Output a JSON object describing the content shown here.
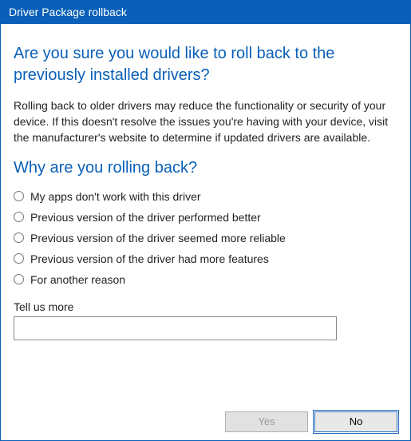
{
  "title": "Driver Package rollback",
  "heading": "Are you sure you would like to roll back to the previously installed drivers?",
  "body": "Rolling back to older drivers may reduce the functionality or security of your device.  If this doesn't resolve the issues you're having with your device, visit the manufacturer's website to determine if updated drivers are available.",
  "subheading": "Why are you rolling back?",
  "options": [
    "My apps don't work with this driver",
    "Previous version of the driver performed better",
    "Previous version of the driver seemed more reliable",
    "Previous version of the driver had more features",
    "For another reason"
  ],
  "tellus_label": "Tell us more",
  "tellus_value": "",
  "buttons": {
    "yes": "Yes",
    "no": "No"
  }
}
